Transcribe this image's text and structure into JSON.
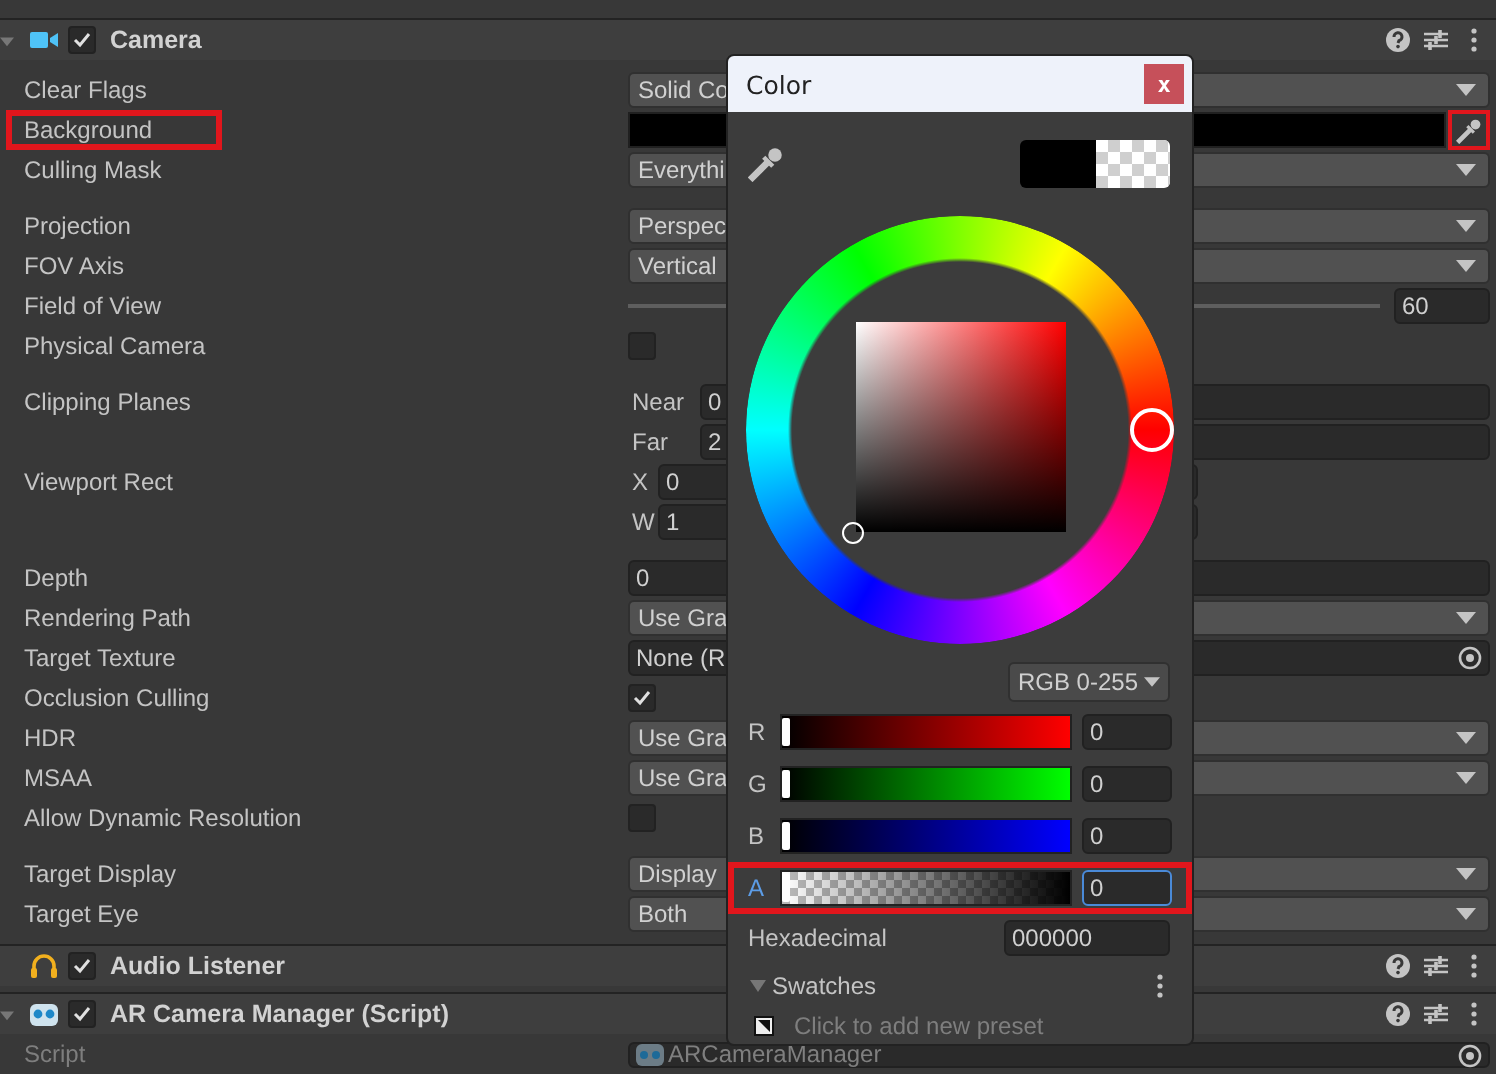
{
  "components": [
    {
      "title": "Camera",
      "kind": "camera",
      "expanded": true,
      "enabled": true,
      "groups": [
        {
          "rows": [
            {
              "kind": "dropdown",
              "label": "Clear Flags",
              "value": "Solid Co"
            },
            {
              "kind": "color",
              "label": "Background",
              "highlighted": true,
              "eyedropper_highlighted": true
            },
            {
              "kind": "dropdown",
              "label": "Culling Mask",
              "value": "Everythi"
            }
          ]
        },
        {
          "rows": [
            {
              "kind": "dropdown",
              "label": "Projection",
              "value": "Perspec"
            },
            {
              "kind": "dropdown",
              "label": "FOV Axis",
              "value": "Vertical"
            },
            {
              "kind": "slider",
              "label": "Field of View",
              "value": "60"
            },
            {
              "kind": "checkbox",
              "label": "Physical Camera",
              "checked": false
            }
          ]
        },
        {
          "rows": [
            {
              "kind": "labeled",
              "label": "Clipping Planes",
              "sublabel": "Near",
              "value": "0"
            },
            {
              "kind": "labeled",
              "sublabel": "Far",
              "value": "2"
            },
            {
              "kind": "vector",
              "label": "Viewport Rect",
              "sublabel": "X",
              "value": "0"
            },
            {
              "kind": "vector",
              "sublabel": "W",
              "value": "1"
            }
          ]
        },
        {
          "rows": [
            {
              "kind": "number",
              "label": "Depth",
              "value": "0"
            },
            {
              "kind": "dropdown",
              "label": "Rendering Path",
              "value": "Use Gra"
            },
            {
              "kind": "object",
              "label": "Target Texture",
              "value": "None (R"
            },
            {
              "kind": "checkbox",
              "label": "Occlusion Culling",
              "checked": true
            },
            {
              "kind": "dropdown",
              "label": "HDR",
              "value": "Use Gra"
            },
            {
              "kind": "dropdown",
              "label": "MSAA",
              "value": "Use Gra"
            },
            {
              "kind": "checkbox",
              "label": "Allow Dynamic Resolution",
              "checked": false
            }
          ]
        },
        {
          "rows": [
            {
              "kind": "dropdown",
              "label": "Target Display",
              "value": "Display"
            },
            {
              "kind": "dropdown",
              "label": "Target Eye",
              "value": "Both"
            }
          ]
        }
      ]
    },
    {
      "title": "Audio Listener",
      "kind": "headphones",
      "enabled": true
    },
    {
      "title": "AR Camera Manager (Script)",
      "kind": "robot",
      "expanded": true,
      "enabled": true,
      "groups": [
        {
          "rows": [
            {
              "kind": "script",
              "label": "Script",
              "value": "ARCameraManager",
              "disabled": true
            }
          ]
        }
      ]
    }
  ],
  "color_picker": {
    "title": "Color",
    "close_label": "x",
    "mode": "RGB 0-255",
    "channels": [
      {
        "label": "R",
        "kind": "color",
        "color": "#ff0000",
        "level": 0,
        "value": "0",
        "focused": false,
        "highlighted": false
      },
      {
        "label": "G",
        "kind": "color",
        "color": "#00ff00",
        "level": 0,
        "value": "0",
        "focused": false,
        "highlighted": false
      },
      {
        "label": "B",
        "kind": "color",
        "color": "#0000ff",
        "level": 0,
        "value": "0",
        "focused": false,
        "highlighted": false
      },
      {
        "label": "A",
        "kind": "alpha",
        "level": 0,
        "value": "0",
        "focused": true,
        "highlighted": true
      }
    ],
    "hex_label": "Hexadecimal",
    "hex": "000000",
    "swatches": {
      "label": "Swatches",
      "expanded": true,
      "hint": "Click to add new preset"
    }
  }
}
